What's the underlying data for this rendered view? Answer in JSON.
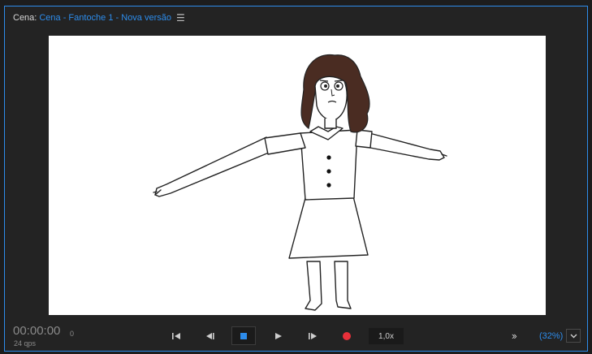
{
  "header": {
    "label": "Cena:",
    "scene_name": "Cena - Fantoche 1 - Nova versão",
    "menu_icon": "hamburger-icon"
  },
  "status": {
    "timecode": "00:00:00",
    "frame": "0",
    "fps": "24 qps"
  },
  "transport": {
    "speed": "1,0x",
    "zoom": "(32%)"
  },
  "colors": {
    "accent": "#2d8ceb",
    "record": "#e8303a",
    "hair": "#4a2c22"
  }
}
